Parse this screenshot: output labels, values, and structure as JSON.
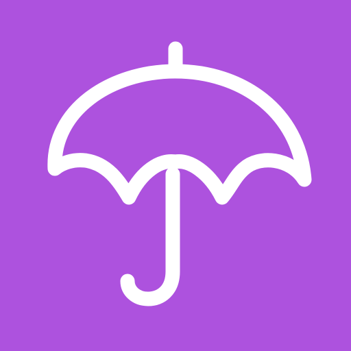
{
  "icon": {
    "name": "umbrella-icon",
    "background_color": "#ad52de",
    "glyph_color": "#ffffff"
  }
}
